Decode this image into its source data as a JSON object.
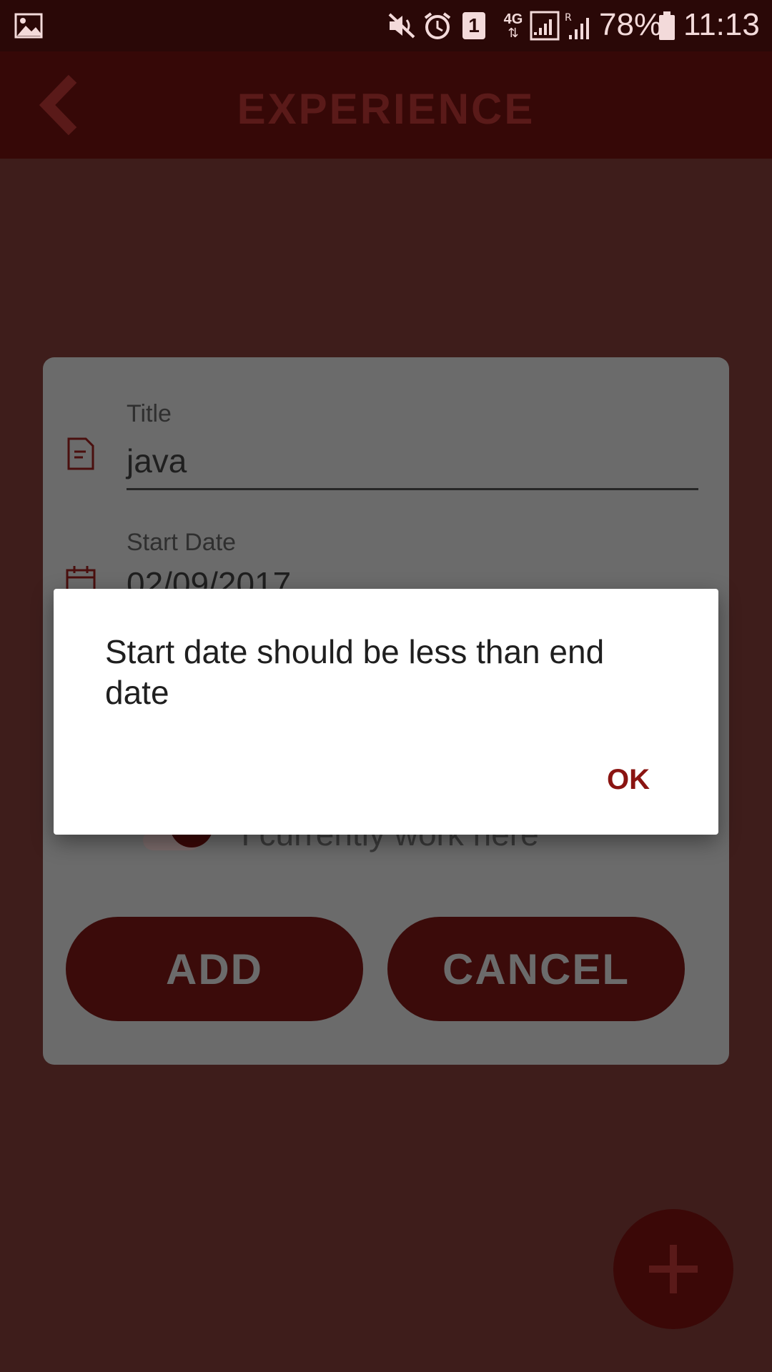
{
  "status_bar": {
    "battery": "78%",
    "time": "11:13",
    "notification_badge": "1",
    "network": "4G",
    "icons": [
      "image-icon",
      "mute-icon",
      "alarm-icon",
      "sim-badge-icon",
      "network-icon",
      "signal-icon",
      "roaming-signal-icon",
      "battery-icon"
    ]
  },
  "app_bar": {
    "title": "EXPERIENCE",
    "back_icon": "chevron-left-icon"
  },
  "form": {
    "title_label": "Title",
    "title_value": "java",
    "start_date_label": "Start Date",
    "start_date_value": "02/09/2017",
    "current_work_label": "I currently work here",
    "add_label": "ADD",
    "cancel_label": "CANCEL"
  },
  "dialog": {
    "message": "Start date should be less than end date",
    "ok_label": "OK"
  },
  "fab": {
    "icon": "plus-icon"
  },
  "colors": {
    "accent": "#8a1411",
    "app_bar": "#360807",
    "overlay_bg": "#3e1d1b"
  }
}
